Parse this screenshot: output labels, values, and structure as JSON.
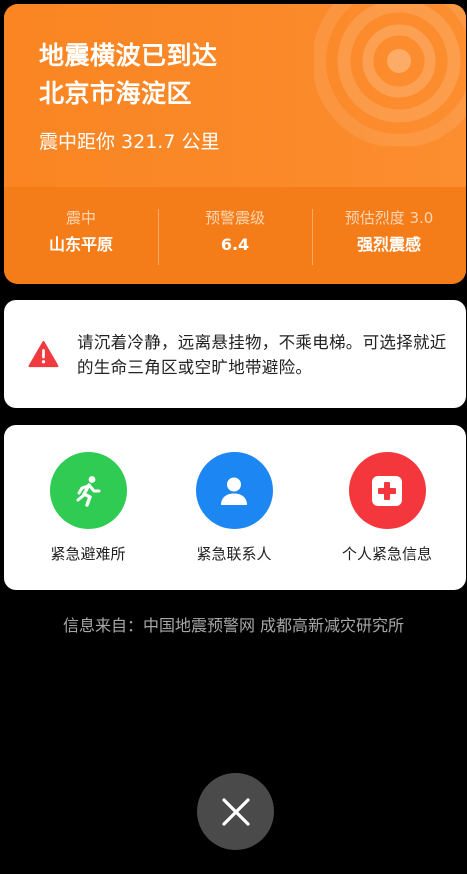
{
  "alert": {
    "title_line1": "地震横波已到达",
    "title_line2": "北京市海淀区",
    "distance": "震中距你 321.7 公里",
    "stats": [
      {
        "label": "震中",
        "value": "山东平原"
      },
      {
        "label": "预警震级",
        "value": "6.4"
      },
      {
        "label": "预估烈度 3.0",
        "value": "强烈震感"
      }
    ],
    "colors": {
      "top": "#FA8522",
      "bottom": "#F47D1A"
    }
  },
  "warning": {
    "icon": "warning-triangle-icon",
    "text": "请沉着冷静，远离悬挂物，不乘电梯。可选择就近的生命三角区或空旷地带避险。",
    "color": "#F03A3F"
  },
  "actions": [
    {
      "label": "紧急避难所",
      "icon": "running-person-icon",
      "color": "#2FCB52"
    },
    {
      "label": "紧急联系人",
      "icon": "contact-person-icon",
      "color": "#1C86F3"
    },
    {
      "label": "个人紧急信息",
      "icon": "medical-cross-icon",
      "color": "#F3373D"
    }
  ],
  "source": "信息来自：中国地震预警网 成都高新减灾研究所",
  "close": {
    "icon": "close-icon"
  }
}
